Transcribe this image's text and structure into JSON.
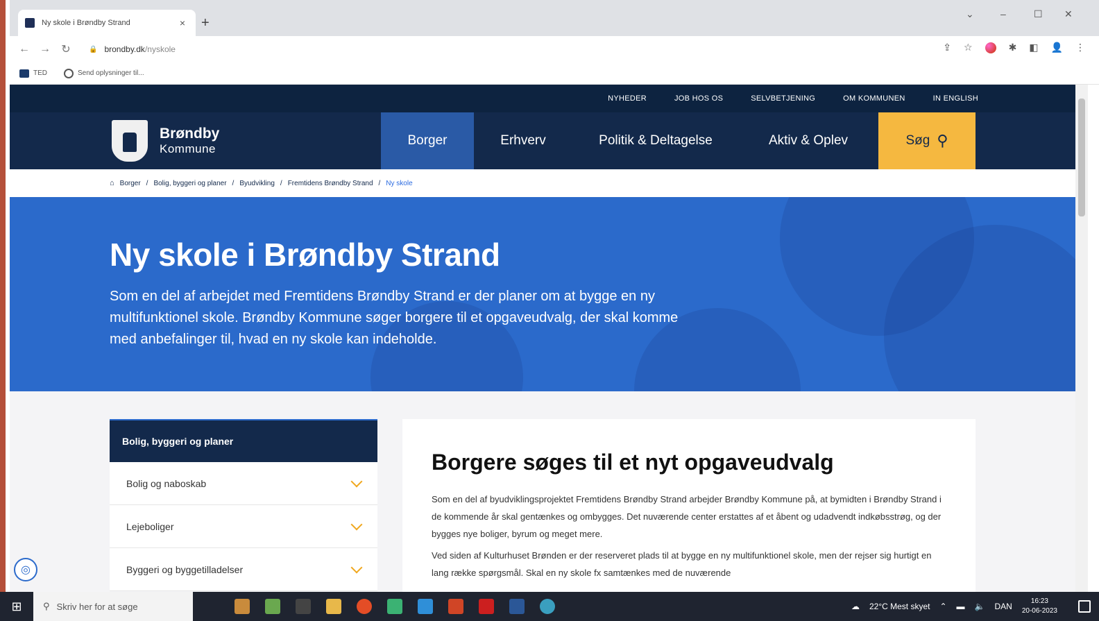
{
  "browser": {
    "tab_title": "Ny skole i Brøndby Strand",
    "tab_close": "×",
    "new_tab": "+",
    "url_host": "brondby.dk",
    "url_path": "/nyskole",
    "bookmarks": [
      "TED",
      "Send oplysninger til..."
    ],
    "win_min": "–",
    "win_max": "☐",
    "win_close": "✕",
    "win_dropdown": "⌄"
  },
  "site": {
    "top_links": [
      "NYHEDER",
      "JOB HOS OS",
      "SELVBETJENING",
      "OM KOMMUNEN",
      "IN ENGLISH"
    ],
    "logo_name": "Brøndby",
    "logo_sub": "Kommune",
    "menu": [
      "Borger",
      "Erhverv",
      "Politik & Deltagelse",
      "Aktiv & Oplev"
    ],
    "search_label": "Søg",
    "breadcrumb": [
      "Borger",
      "Bolig, byggeri og planer",
      "Byudvikling",
      "Fremtidens Brøndby Strand",
      "Ny skole"
    ]
  },
  "hero": {
    "title": "Ny skole i Brøndby Strand",
    "lead": "Som en del af arbejdet med Fremtidens Brøndby Strand er der planer om at bygge en ny multifunktionel skole. Brøndby Kommune søger borgere til et opgaveudvalg, der skal komme med anbefalinger til, hvad en ny skole kan indeholde."
  },
  "sidenav": {
    "header": "Bolig, byggeri og planer",
    "items": [
      "Bolig og naboskab",
      "Lejeboliger",
      "Byggeri og byggetilladelser"
    ]
  },
  "article": {
    "heading": "Borgere søges til et nyt opgaveudvalg",
    "p1": "Som en del af byudviklingsprojektet Fremtidens Brøndby Strand arbejder Brøndby Kommune på, at bymidten i Brøndby Strand i de kommende år skal gentænkes og ombygges. Det nuværende center erstattes af et åbent og udadvendt indkøbsstrøg, og der bygges nye boliger, byrum og meget mere.",
    "p2": "Ved siden af Kulturhuset Brønden er der reserveret plads til at bygge en ny multifunktionel skole, men der rejser sig hurtigt en lang række spørgsmål. Skal en ny skole fx samtænkes med de nuværende"
  },
  "taskbar": {
    "search_placeholder": "Skriv her for at søge",
    "weather": "22°C  Mest skyet",
    "lang": "DAN",
    "time": "16:23",
    "date": "20-06-2023"
  }
}
